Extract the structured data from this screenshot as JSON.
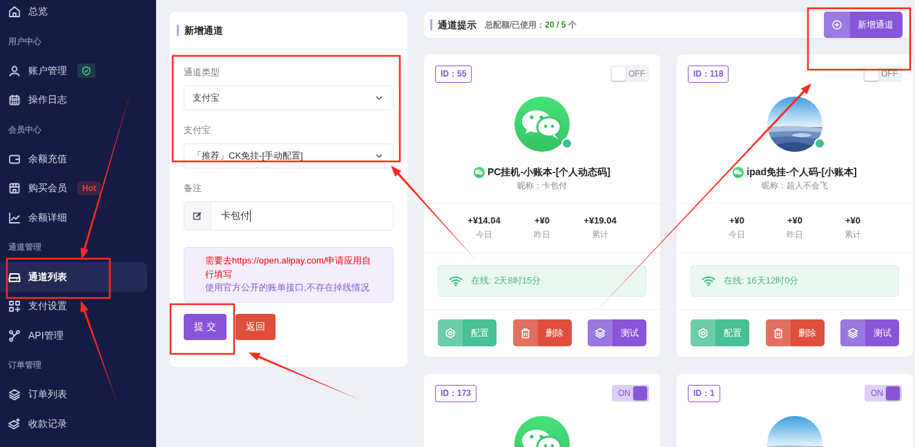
{
  "sidebar": {
    "items": [
      {
        "kind": "link",
        "label": "总览",
        "selected": false
      },
      {
        "kind": "section",
        "label": "用户中心"
      },
      {
        "kind": "link",
        "label": "账户管理",
        "selected": false,
        "badge": {
          "kind": "shield"
        }
      },
      {
        "kind": "link",
        "label": "操作日志",
        "selected": false
      },
      {
        "kind": "section",
        "label": "会员中心"
      },
      {
        "kind": "link",
        "label": "余额充值",
        "selected": false
      },
      {
        "kind": "link",
        "label": "购买会员",
        "selected": false,
        "badge": {
          "kind": "text",
          "text": "Hot"
        }
      },
      {
        "kind": "link",
        "label": "余额详细",
        "selected": false
      },
      {
        "kind": "section",
        "label": "通道管理"
      },
      {
        "kind": "link",
        "label": "通道列表",
        "selected": true
      },
      {
        "kind": "link",
        "label": "支付设置",
        "selected": false
      },
      {
        "kind": "link",
        "label": "API管理",
        "selected": false
      },
      {
        "kind": "section",
        "label": "订单管理"
      },
      {
        "kind": "link",
        "label": "订单列表",
        "selected": false
      },
      {
        "kind": "link",
        "label": "收款记录",
        "selected": false
      }
    ]
  },
  "form": {
    "title": "新增通道",
    "fields": [
      {
        "kind": "select",
        "label": "通道类型",
        "value": "支付宝"
      },
      {
        "kind": "select",
        "label": "支付宝",
        "value": "「推荐」CK免挂-[手动配置]"
      },
      {
        "kind": "input",
        "label": "备注",
        "value": "卡包付"
      }
    ],
    "notice": {
      "lines": [
        {
          "text": "需要去https://open.alipay.com/申请应用自行填写",
          "color": "#ff0000"
        },
        {
          "text": "使用官方公开的账单接口,不存在掉线情况",
          "color": "#8a5ad8"
        }
      ]
    },
    "buttons": [
      {
        "kind": "primary",
        "label": "提 交"
      },
      {
        "kind": "danger",
        "label": "返回"
      }
    ]
  },
  "quota": {
    "title": "通道提示",
    "label": "总配额/已使用：",
    "total": "20",
    "separator": "/",
    "used": "5",
    "unit": "个",
    "button": "新增通道"
  },
  "channels": [
    {
      "badge": "ID：55",
      "enabled": false,
      "toggle_text": "OFF",
      "avatar": {
        "kind": "wechat"
      },
      "online": true,
      "name": "PC挂机-小账本-[个人动态码]",
      "nickname": "昵称：卡包付",
      "stats": [
        {
          "value": "+¥14.04",
          "label": "今日"
        },
        {
          "value": "+¥0",
          "label": "昨日"
        },
        {
          "value": "+¥19.04",
          "label": "累计"
        }
      ],
      "status": "在线: 2天8时15分",
      "actions": [
        {
          "kind": "config",
          "label": "配置"
        },
        {
          "kind": "delete",
          "label": "删除"
        },
        {
          "kind": "test",
          "label": "测试"
        }
      ]
    },
    {
      "badge": "ID：118",
      "enabled": false,
      "toggle_text": "OFF",
      "avatar": {
        "kind": "picture"
      },
      "online": true,
      "name": "ipad免挂-个人码-[小账本]",
      "nickname": "昵称：超人不会飞",
      "stats": [
        {
          "value": "+¥0",
          "label": "今日"
        },
        {
          "value": "+¥0",
          "label": "昨日"
        },
        {
          "value": "+¥0",
          "label": "累计"
        }
      ],
      "status": "在线: 16天12时0分",
      "actions": [
        {
          "kind": "config",
          "label": "配置"
        },
        {
          "kind": "delete",
          "label": "删除"
        },
        {
          "kind": "test",
          "label": "测试"
        }
      ]
    },
    {
      "badge": "ID：173",
      "enabled": true,
      "toggle_text": "ON",
      "avatar": {
        "kind": "wechat"
      }
    },
    {
      "badge": "ID：1",
      "enabled": true,
      "toggle_text": "ON",
      "avatar": {
        "kind": "picture"
      }
    }
  ]
}
